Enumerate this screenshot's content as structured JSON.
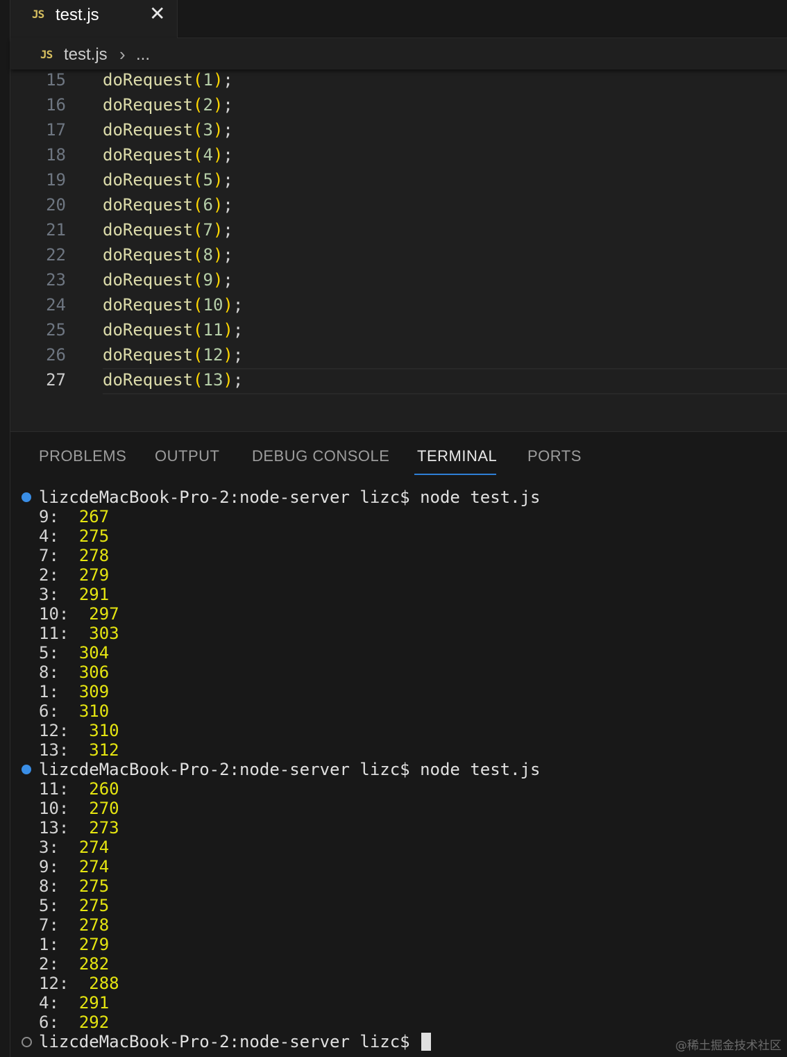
{
  "tab": {
    "badge": "JS",
    "label": "test.js",
    "close": "✕"
  },
  "breadcrumb": {
    "badge": "JS",
    "file": "test.js",
    "chevron": "›",
    "more": "..."
  },
  "editor": {
    "lines": [
      {
        "no": "15",
        "fn": "doRequest",
        "arg": "1"
      },
      {
        "no": "16",
        "fn": "doRequest",
        "arg": "2"
      },
      {
        "no": "17",
        "fn": "doRequest",
        "arg": "3"
      },
      {
        "no": "18",
        "fn": "doRequest",
        "arg": "4"
      },
      {
        "no": "19",
        "fn": "doRequest",
        "arg": "5"
      },
      {
        "no": "20",
        "fn": "doRequest",
        "arg": "6"
      },
      {
        "no": "21",
        "fn": "doRequest",
        "arg": "7"
      },
      {
        "no": "22",
        "fn": "doRequest",
        "arg": "8"
      },
      {
        "no": "23",
        "fn": "doRequest",
        "arg": "9"
      },
      {
        "no": "24",
        "fn": "doRequest",
        "arg": "10"
      },
      {
        "no": "25",
        "fn": "doRequest",
        "arg": "11"
      },
      {
        "no": "26",
        "fn": "doRequest",
        "arg": "12"
      },
      {
        "no": "27",
        "fn": "doRequest",
        "arg": "13"
      }
    ],
    "active_line": "27"
  },
  "panel": {
    "tabs": [
      "PROBLEMS",
      "OUTPUT",
      "DEBUG CONSOLE",
      "TERMINAL",
      "PORTS"
    ],
    "active_tab": "TERMINAL"
  },
  "terminal": {
    "prompt": "lizcdeMacBook-Pro-2:node-server lizc$",
    "runs": [
      {
        "command": "node test.js",
        "output": [
          {
            "key": "9:",
            "value": "267"
          },
          {
            "key": "4:",
            "value": "275"
          },
          {
            "key": "7:",
            "value": "278"
          },
          {
            "key": "2:",
            "value": "279"
          },
          {
            "key": "3:",
            "value": "291"
          },
          {
            "key": "10:",
            "value": "297"
          },
          {
            "key": "11:",
            "value": "303"
          },
          {
            "key": "5:",
            "value": "304"
          },
          {
            "key": "8:",
            "value": "306"
          },
          {
            "key": "1:",
            "value": "309"
          },
          {
            "key": "6:",
            "value": "310"
          },
          {
            "key": "12:",
            "value": "310"
          },
          {
            "key": "13:",
            "value": "312"
          }
        ]
      },
      {
        "command": "node test.js",
        "output": [
          {
            "key": "11:",
            "value": "260"
          },
          {
            "key": "10:",
            "value": "270"
          },
          {
            "key": "13:",
            "value": "273"
          },
          {
            "key": "3:",
            "value": "274"
          },
          {
            "key": "9:",
            "value": "274"
          },
          {
            "key": "8:",
            "value": "275"
          },
          {
            "key": "5:",
            "value": "275"
          },
          {
            "key": "7:",
            "value": "278"
          },
          {
            "key": "1:",
            "value": "279"
          },
          {
            "key": "2:",
            "value": "282"
          },
          {
            "key": "12:",
            "value": "288"
          },
          {
            "key": "4:",
            "value": "291"
          },
          {
            "key": "6:",
            "value": "292"
          }
        ]
      }
    ]
  },
  "watermark": "@稀土掘金技术社区",
  "colors": {
    "background": "#1f1f1f",
    "function": "#dcdcaa",
    "bracket": "#ffd700",
    "number": "#b5cea8",
    "terminal_value": "#e5e510",
    "active_tab_underline": "#2f7fd6",
    "prompt_dot": "#3a8ee6"
  }
}
